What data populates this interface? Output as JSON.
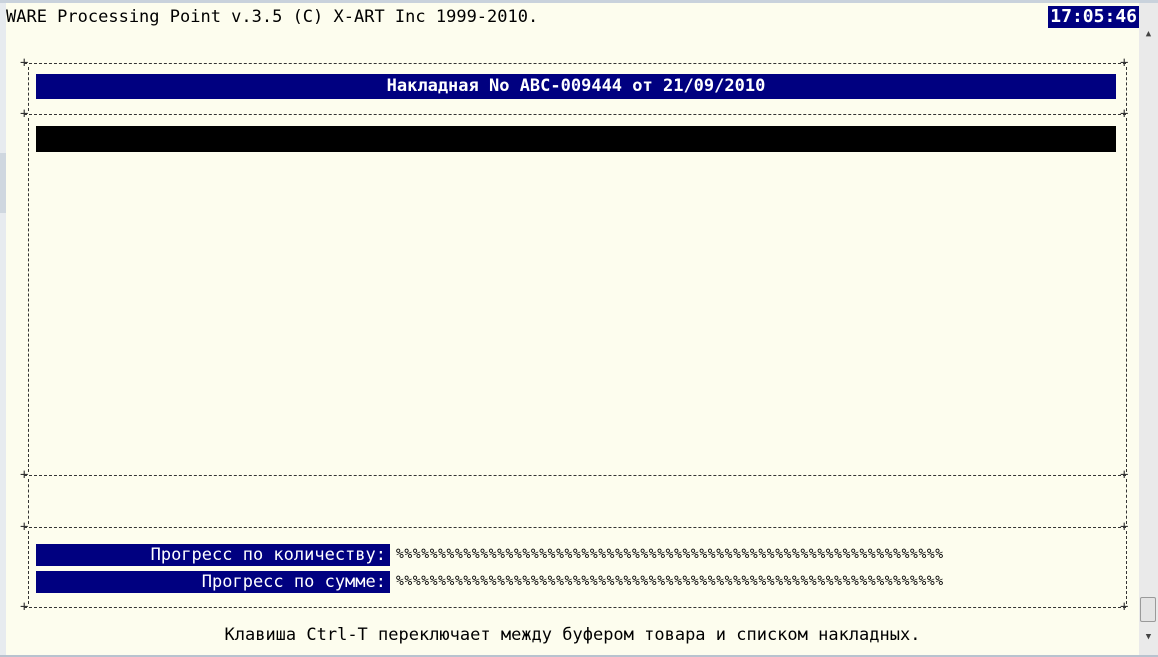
{
  "app": {
    "title": "WARE Processing Point v.3.5 (C) X-ART Inc 1999-2010.",
    "clock": "17:05:46"
  },
  "invoice": {
    "header": "Накладная No ABC-009444 от 21/09/2010"
  },
  "progress": {
    "quantity_label": "Прогресс по количеству:",
    "quantity_value": "%%%%%%%%%%%%%%%%%%%%%%%%%%%%%%%%%%%%%%%%%%%%%%%%%%%%%%%%%%%%%%%%%",
    "sum_label": "Прогресс по сумме:",
    "sum_value": "%%%%%%%%%%%%%%%%%%%%%%%%%%%%%%%%%%%%%%%%%%%%%%%%%%%%%%%%%%%%%%%%%"
  },
  "footer": {
    "hint": "Клавиша Ctrl-T переключает между буфером товара и списком накладных."
  },
  "scrollbar": {
    "up_icon": "triangle-up",
    "down_icon": "triangle-down"
  }
}
